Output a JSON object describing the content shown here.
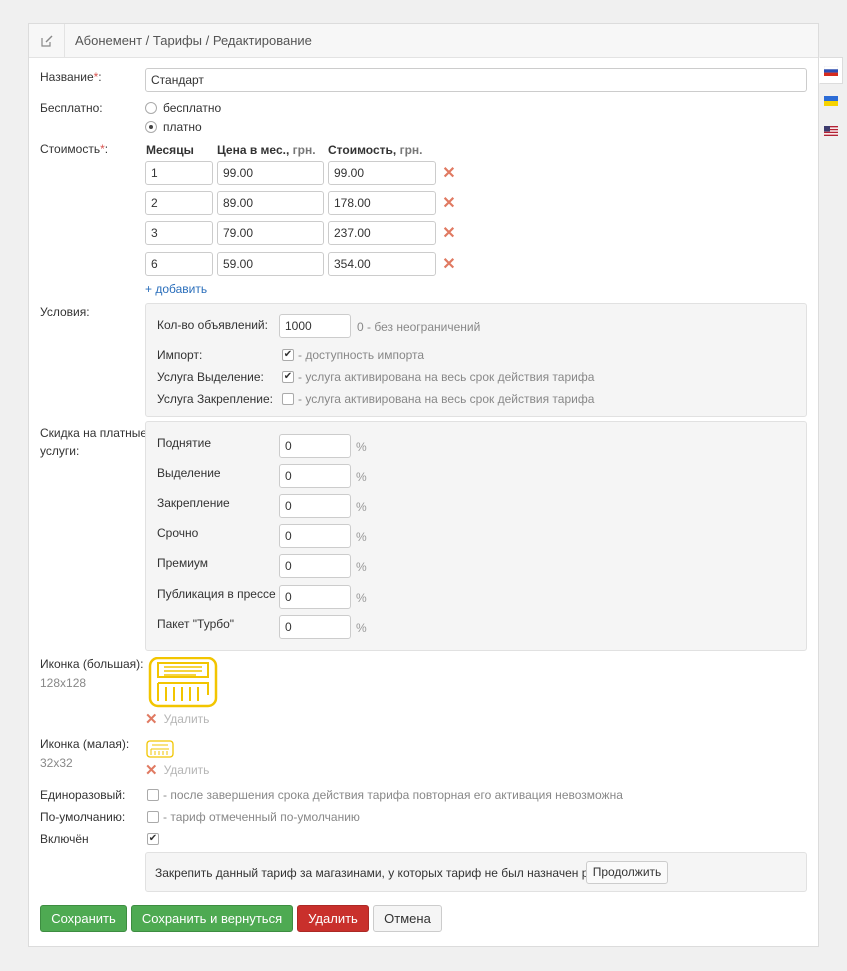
{
  "header": {
    "breadcrumb": "Абонемент / Тарифы / Редактирование",
    "icon": "edit-icon"
  },
  "languages": [
    {
      "code": "ru",
      "colors": [
        "#ffffff",
        "#2a4cb3",
        "#d52b1e"
      ]
    },
    {
      "code": "uk",
      "colors": [
        "#2c6cd6",
        "#f6d300"
      ]
    },
    {
      "code": "en",
      "colors": [
        "#b22234",
        "#ffffff",
        "#3c3b6e"
      ]
    }
  ],
  "form": {
    "name_label": "Название",
    "required_mark": "*",
    "colon": ":",
    "name_value": "Стандарт",
    "free_label": "Бесплатно:",
    "free_option": "бесплатно",
    "paid_option": "платно",
    "cost_label": "Стоимость",
    "price_table": {
      "col_months": "Месяцы",
      "col_price_month": "Цена в мес.,",
      "col_price_month_unit": "грн.",
      "col_total": "Стоимость,",
      "col_total_unit": "грн.",
      "rows": [
        {
          "months": "1",
          "price": "99.00",
          "total": "99.00"
        },
        {
          "months": "2",
          "price": "89.00",
          "total": "178.00"
        },
        {
          "months": "3",
          "price": "79.00",
          "total": "237.00"
        },
        {
          "months": "6",
          "price": "59.00",
          "total": "354.00"
        }
      ],
      "add_link": "+ добавить"
    },
    "conditions_label": "Условия:",
    "conditions": {
      "ads_count_label": "Кол-во объявлений:",
      "ads_count_value": "1000",
      "ads_count_hint": "0 - без неограничений",
      "import_label": "Импорт:",
      "import_hint": "- доступность импорта",
      "highlight_label": "Услуга Выделение:",
      "highlight_hint": "- услуга активирована на весь срок действия тарифа",
      "pin_label": "Услуга Закрепление:",
      "pin_hint": "- услуга активирована на весь срок действия тарифа"
    },
    "discount_label_1": "Скидка на платные",
    "discount_label_2": "услуги:",
    "discounts": [
      {
        "label": "Поднятие",
        "value": "0"
      },
      {
        "label": "Выделение",
        "value": "0"
      },
      {
        "label": "Закрепление",
        "value": "0"
      },
      {
        "label": "Срочно",
        "value": "0"
      },
      {
        "label": "Премиум",
        "value": "0"
      },
      {
        "label": "Публикация в прессе",
        "value": "0"
      },
      {
        "label": "Пакет \"Турбо\"",
        "value": "0"
      }
    ],
    "percent": "%",
    "icon_big_label": "Иконка (большая):",
    "icon_big_size": "128x128",
    "icon_small_label": "Иконка (малая):",
    "icon_small_size": "32x32",
    "icon_delete": "Удалить",
    "icon_color": "#f2c500",
    "onetime_label": "Единоразовый:",
    "onetime_hint": "- после завершения срока действия тарифа повторная его активация невозможна",
    "default_label": "По-умолчанию:",
    "default_hint": "- тариф отмеченный по-умолчанию",
    "enabled_label": "Включён",
    "assign_text": "Закрепить данный тариф за магазинами, у которых тариф не был назначен ранее:",
    "assign_button": "Продолжить"
  },
  "actions": {
    "save": "Сохранить",
    "save_return": "Сохранить и вернуться",
    "delete": "Удалить",
    "cancel": "Отмена"
  },
  "colors": {
    "green": "#4eaa52",
    "red": "#c9302c",
    "link": "#2a6ebb"
  }
}
